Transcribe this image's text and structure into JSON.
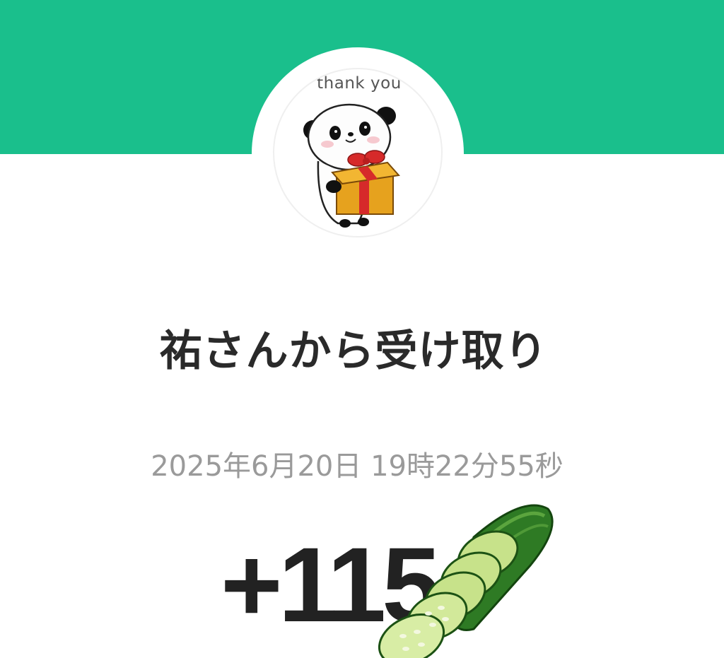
{
  "header": {
    "band_color": "#1ABF8C"
  },
  "sticker": {
    "caption": "thank you",
    "icon": "panda-gift-icon"
  },
  "receipt": {
    "title": "祐さんから受け取り",
    "timestamp": "2025年6月20日 19時22分55秒",
    "amount": "+115",
    "amount_icon": "cucumber-icon"
  }
}
